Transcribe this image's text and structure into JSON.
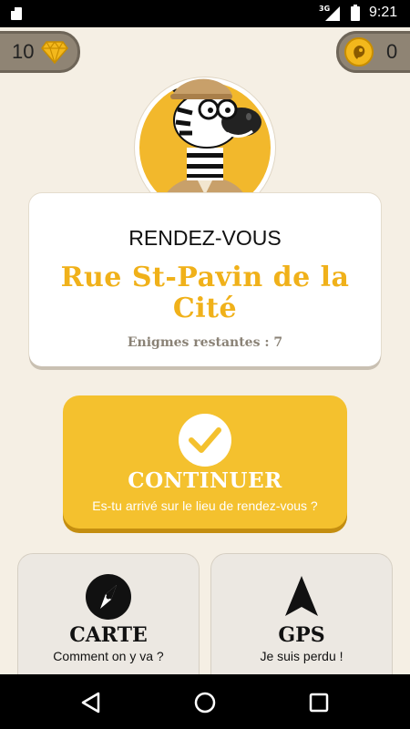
{
  "status_bar": {
    "network": "3G",
    "time": "9:21"
  },
  "counters": {
    "diamonds": "10",
    "coins": "0"
  },
  "card": {
    "title": "RENDEZ-VOUS",
    "place": "Rue St-Pavin de la Cité",
    "remaining": "Enigmes restantes : 7"
  },
  "continue_button": {
    "label": "CONTINUER",
    "subtitle": "Es-tu arrivé sur le lieu de rendez-vous ?"
  },
  "map_button": {
    "label": "CARTE",
    "subtitle": "Comment on y va ?"
  },
  "gps_button": {
    "label": "GPS",
    "subtitle": "Je suis perdu !"
  },
  "colors": {
    "accent": "#f4c12e",
    "background": "#f5efe4",
    "place_text": "#f0b11a"
  }
}
